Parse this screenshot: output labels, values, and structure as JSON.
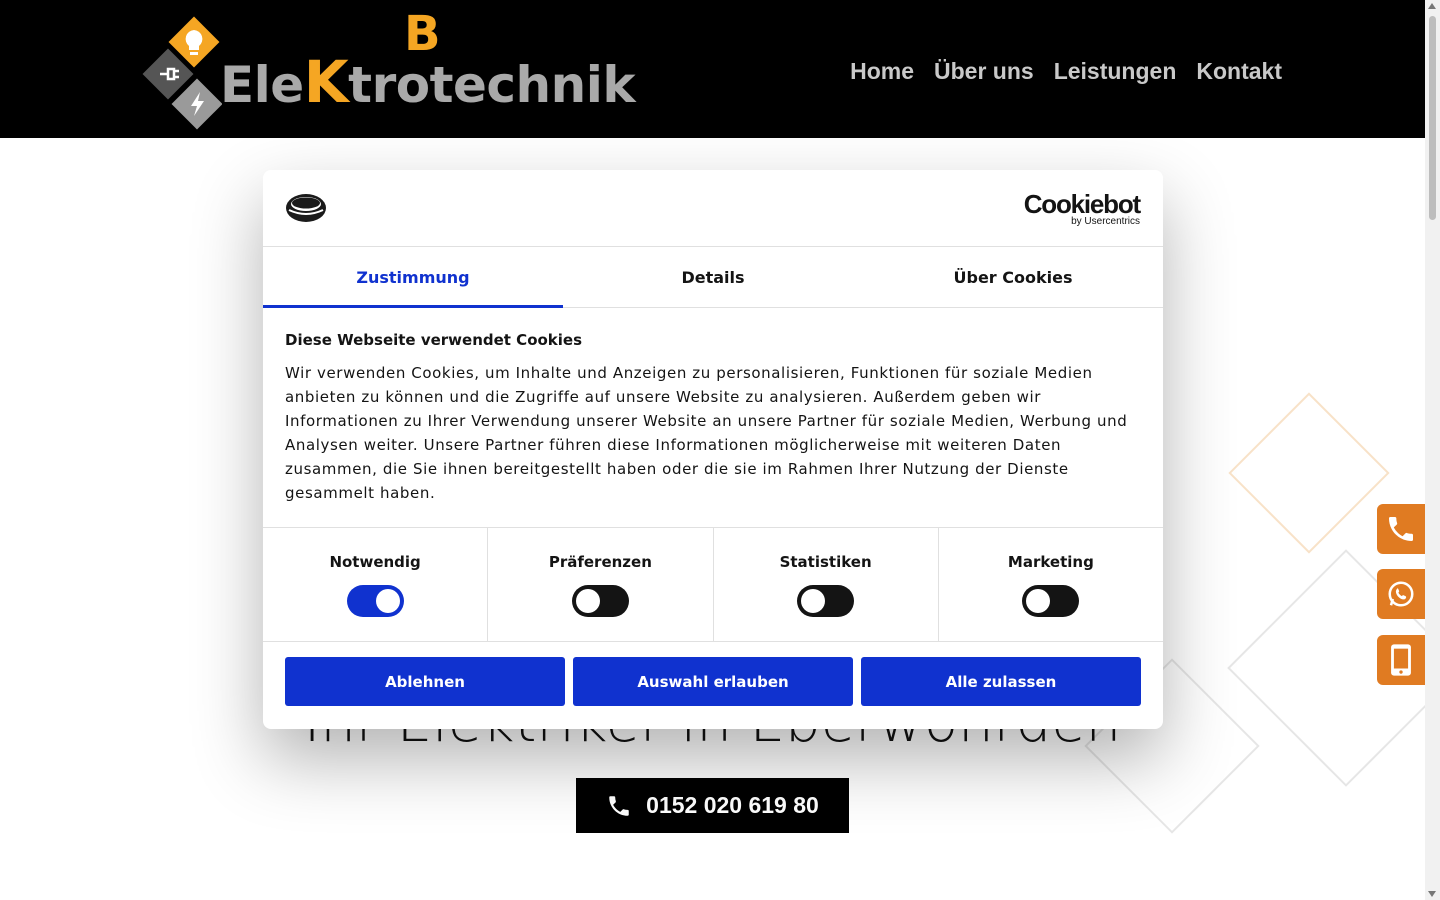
{
  "header": {
    "logo_b": "B",
    "logo_text_pre": "Ele",
    "logo_text_k": "K",
    "logo_text_post": "trotechnik",
    "nav": [
      "Home",
      "Über uns",
      "Leistungen",
      "Kontakt"
    ]
  },
  "hero": {
    "headline": "Ihr Elektriker in Eberwöhrden",
    "phone": "0152 020 619 80"
  },
  "side_buttons": [
    "phone-icon",
    "whatsapp-icon",
    "mobile-icon"
  ],
  "cookie_dialog": {
    "brand_name": "Cookiebot",
    "brand_sub": "by Usercentrics",
    "tabs": [
      "Zustimmung",
      "Details",
      "Über Cookies"
    ],
    "active_tab": "Zustimmung",
    "title": "Diese Webseite verwendet Cookies",
    "text": "Wir verwenden Cookies, um Inhalte und Anzeigen zu personalisieren, Funktionen für soziale Medien anbieten zu können und die Zugriffe auf unsere Website zu analysieren. Außerdem geben wir Informationen zu Ihrer Verwendung unserer Website an unsere Partner für soziale Medien, Werbung und Analysen weiter. Unsere Partner führen diese Informationen möglicherweise mit weiteren Daten zusammen, die Sie ihnen bereitgestellt haben oder die sie im Rahmen Ihrer Nutzung der Dienste gesammelt haben.",
    "toggles": [
      {
        "label": "Notwendig",
        "on": true
      },
      {
        "label": "Präferenzen",
        "on": false
      },
      {
        "label": "Statistiken",
        "on": false
      },
      {
        "label": "Marketing",
        "on": false
      }
    ],
    "buttons": {
      "decline": "Ablehnen",
      "allow_selection": "Auswahl erlauben",
      "allow_all": "Alle zulassen"
    }
  },
  "colors": {
    "accent_blue": "#1032cf",
    "brand_orange": "#f5a623",
    "side_orange": "#e07b22"
  }
}
